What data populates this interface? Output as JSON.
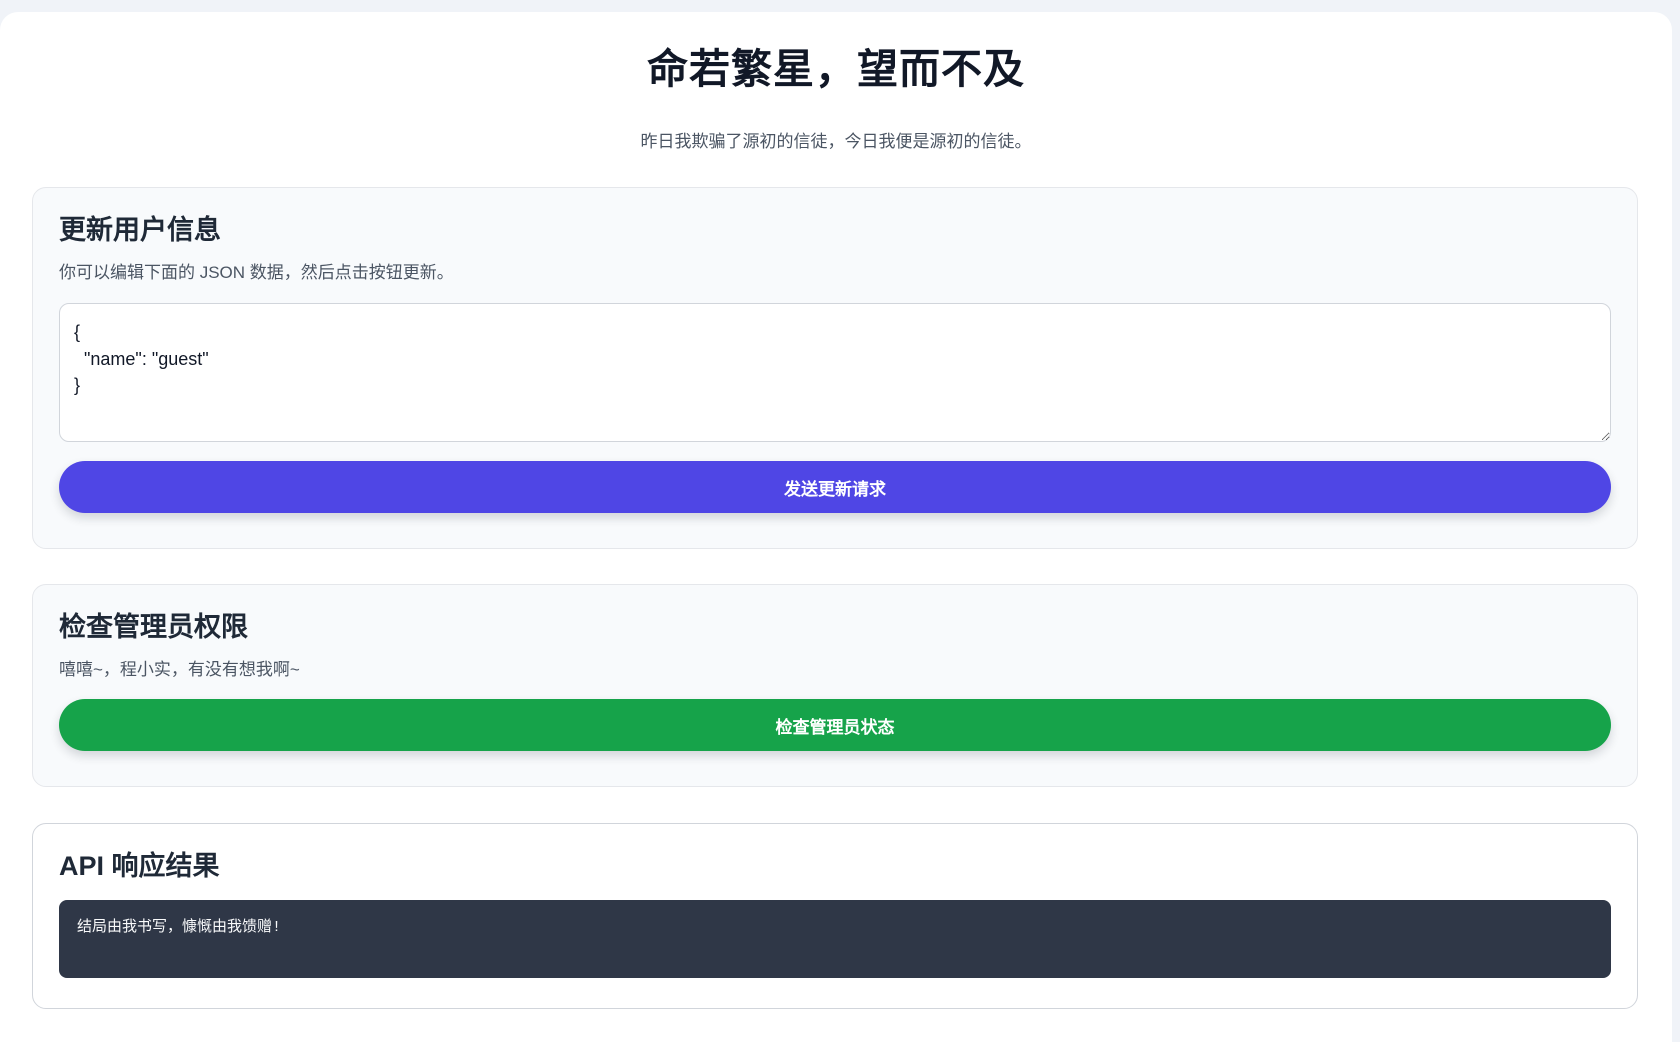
{
  "header": {
    "title": "命若繁星，望而不及",
    "subtitle": "昨日我欺骗了源初的信徒，今日我便是源初的信徒。"
  },
  "update_user": {
    "title": "更新用户信息",
    "description": "你可以编辑下面的 JSON 数据，然后点击按钮更新。",
    "json_value": "{\n  \"name\": \"guest\"\n}",
    "button_label": "发送更新请求"
  },
  "admin_check": {
    "title": "检查管理员权限",
    "description": "嘻嘻~，程小实，有没有想我啊~",
    "button_label": "检查管理员状态"
  },
  "api_result": {
    "title": "API 响应结果",
    "output": "结局由我书写，慷慨由我馈赠!"
  },
  "colors": {
    "page_background": "#f0f3f8",
    "primary_button": "#4f46e5",
    "success_button": "#16a34a",
    "output_background": "#2f3747"
  }
}
